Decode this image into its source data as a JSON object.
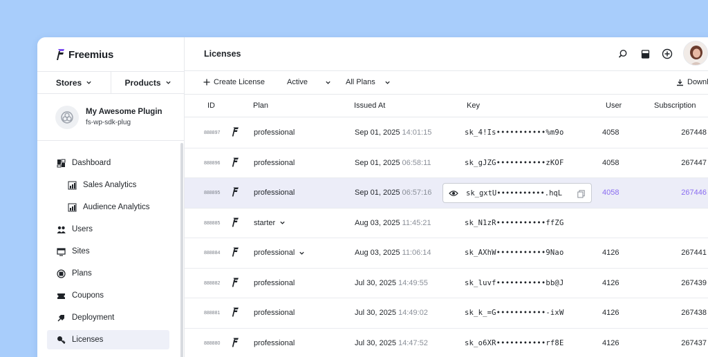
{
  "brand": {
    "name": "Freemius"
  },
  "stores": {
    "stores_label": "Stores",
    "products_label": "Products"
  },
  "plugin": {
    "title": "My Awesome Plugin",
    "slug": "fs-wp-sdk-plug"
  },
  "nav": [
    {
      "label": "Dashboard",
      "icon": "dashboard-icon"
    },
    {
      "label": "Sales Analytics",
      "icon": "chart-icon"
    },
    {
      "label": "Audience Analytics",
      "icon": "chart-icon"
    },
    {
      "label": "Users",
      "icon": "users-icon"
    },
    {
      "label": "Sites",
      "icon": "sites-icon"
    },
    {
      "label": "Plans",
      "icon": "plans-icon"
    },
    {
      "label": "Coupons",
      "icon": "coupon-icon"
    },
    {
      "label": "Deployment",
      "icon": "deployment-icon"
    },
    {
      "label": "Licenses",
      "icon": "key-icon"
    }
  ],
  "header": {
    "title": "Licenses"
  },
  "toolbar": {
    "create_label": "Create License",
    "status_value": "Active",
    "plans_value": "All Plans",
    "download_label": "Downl"
  },
  "columns": {
    "id": "ID",
    "plan": "Plan",
    "issued": "Issued At",
    "key": "Key",
    "user": "User",
    "subscription": "Subscription"
  },
  "rows": [
    {
      "id": "888897",
      "plan": "professional",
      "date": "Sep 01, 2025",
      "time": "14:01:15",
      "key": "sk_4!Is•••••••••••%m9o",
      "user": "4058",
      "sub": "267448"
    },
    {
      "id": "888896",
      "plan": "professional",
      "date": "Sep 01, 2025",
      "time": "06:58:11",
      "key": "sk_gJZG•••••••••••zKOF",
      "user": "4058",
      "sub": "267447"
    },
    {
      "id": "888895",
      "plan": "professional",
      "date": "Sep 01, 2025",
      "time": "06:57:16",
      "key": "sk_gxtU•••••••••••.hqL",
      "user": "4058",
      "sub": "267446"
    },
    {
      "id": "888885",
      "plan": "starter",
      "date": "Aug 03, 2025",
      "time": "11:45:21",
      "key": "sk_N1zR•••••••••••ffZG",
      "user": "",
      "sub": ""
    },
    {
      "id": "888884",
      "plan": "professional",
      "date": "Aug 03, 2025",
      "time": "11:06:14",
      "key": "sk_AXhW•••••••••••9Nao",
      "user": "4126",
      "sub": "267441"
    },
    {
      "id": "888882",
      "plan": "professional",
      "date": "Jul 30, 2025",
      "time": "14:49:55",
      "key": "sk_luvf•••••••••••bb@J",
      "user": "4126",
      "sub": "267439"
    },
    {
      "id": "888881",
      "plan": "professional",
      "date": "Jul 30, 2025",
      "time": "14:49:02",
      "key": "sk_k_=G•••••••••••-ixW",
      "user": "4126",
      "sub": "267438"
    },
    {
      "id": "888880",
      "plan": "professional",
      "date": "Jul 30, 2025",
      "time": "14:47:52",
      "key": "sk_o6XR•••••••••••rf8E",
      "user": "4126",
      "sub": "267437"
    }
  ],
  "colors": {
    "brand": "#7b4cf0",
    "accent": "#8a6cf0",
    "background": "#a8cdfb"
  }
}
